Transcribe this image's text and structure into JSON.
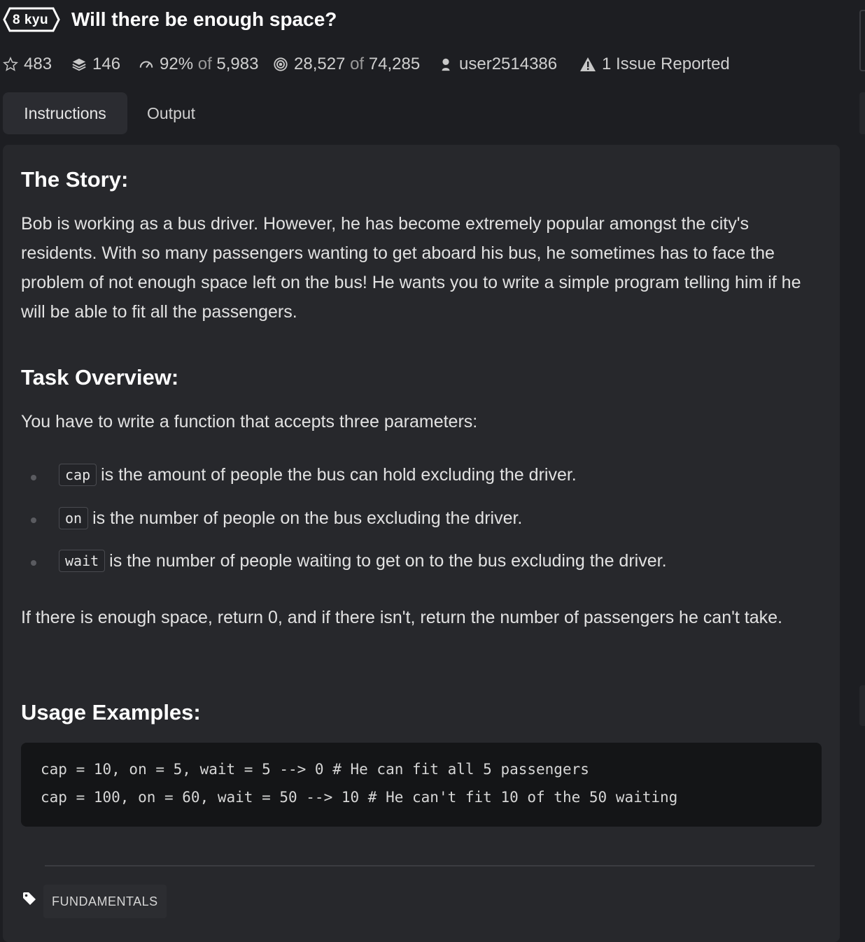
{
  "header": {
    "kyu": "8 kyu",
    "title": "Will there be enough space?"
  },
  "stats": {
    "stars": "483",
    "collections": "146",
    "satisfaction": "92%",
    "satisfaction_of": "of",
    "satisfaction_total": "5,983",
    "completed": "28,527",
    "completed_of": "of",
    "completed_total": "74,285",
    "author": "user2514386",
    "issues": "1 Issue Reported"
  },
  "tabs": [
    {
      "label": "Instructions",
      "active": true
    },
    {
      "label": "Output",
      "active": false
    }
  ],
  "content": {
    "story_heading": "The Story:",
    "story_text": "Bob is working as a bus driver. However, he has become extremely popular amongst the city's residents. With so many passengers wanting to get aboard his bus, he sometimes has to face the problem of not enough space left on the bus! He wants you to write a simple program telling him if he will be able to fit all the passengers.",
    "overview_heading": "Task Overview:",
    "overview_text": "You have to write a function that accepts three parameters:",
    "params": [
      {
        "code": "cap",
        "text": "is the amount of people the bus can hold excluding the driver."
      },
      {
        "code": "on",
        "text": "is the number of people on the bus excluding the driver."
      },
      {
        "code": "wait",
        "text": "is the number of people waiting to get on to the bus excluding the driver."
      }
    ],
    "return_text": "If there is enough space, return 0, and if there isn't, return the number of passengers he can't take.",
    "usage_heading": "Usage Examples:",
    "code_lines": [
      "cap = 10, on = 5, wait = 5 --> 0 # He can fit all 5 passengers",
      "cap = 100, on = 60, wait = 50 --> 10 # He can't fit 10 of the 50 waiting"
    ],
    "tag": "FUNDAMENTALS"
  },
  "colors": {
    "background": "#1d1e22",
    "panel": "#27282c",
    "codeblock": "#141517"
  }
}
